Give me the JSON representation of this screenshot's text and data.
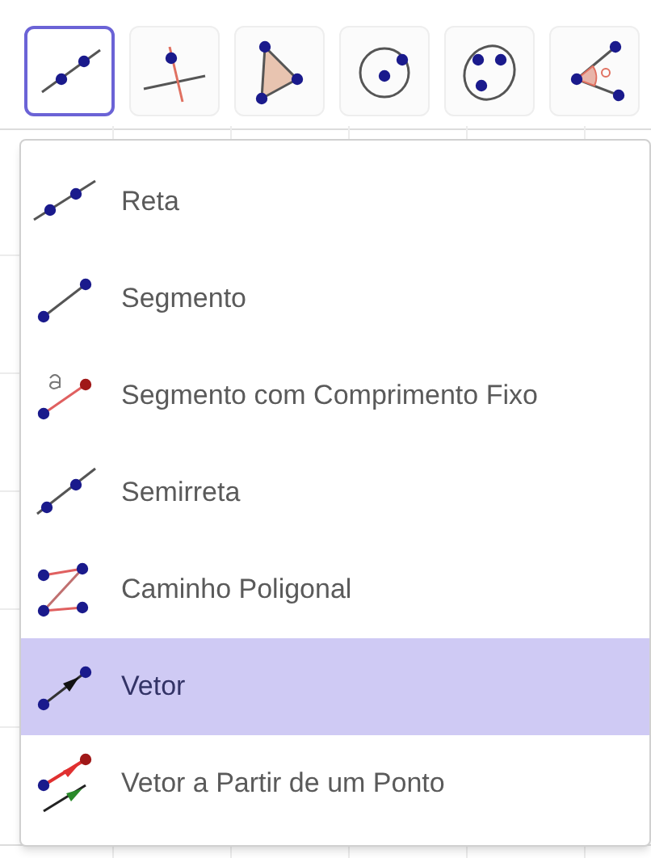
{
  "toolbar": {
    "tools": [
      {
        "kind": "line",
        "selected": true
      },
      {
        "kind": "perpendicular",
        "selected": false
      },
      {
        "kind": "polygon",
        "selected": false
      },
      {
        "kind": "circle",
        "selected": false
      },
      {
        "kind": "conic",
        "selected": false
      },
      {
        "kind": "angle",
        "selected": false
      }
    ]
  },
  "menu": {
    "items": [
      {
        "kind": "line",
        "label": "Reta",
        "selected": false
      },
      {
        "kind": "segment",
        "label": "Segmento",
        "selected": false
      },
      {
        "kind": "fixed-segment",
        "label": "Segmento com Comprimento Fixo",
        "selected": false
      },
      {
        "kind": "ray",
        "label": "Semirreta",
        "selected": false
      },
      {
        "kind": "polyline",
        "label": "Caminho Poligonal",
        "selected": false
      },
      {
        "kind": "vector",
        "label": "Vetor",
        "selected": true
      },
      {
        "kind": "vector-from-point",
        "label": "Vetor a Partir de um Ponto",
        "selected": false
      }
    ]
  }
}
